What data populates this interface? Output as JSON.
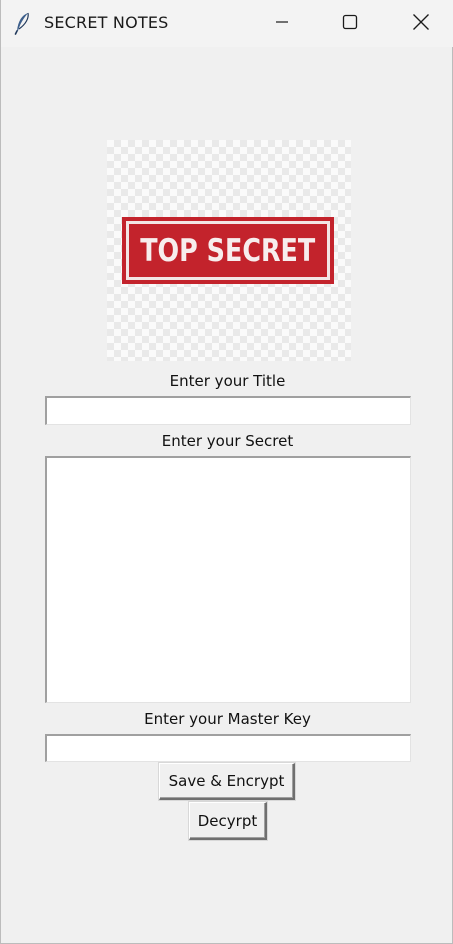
{
  "window": {
    "title": "SECRET NOTES",
    "icon": "feather-icon",
    "controls": [
      "minimize-icon",
      "maximize-icon",
      "close-icon"
    ]
  },
  "logo": {
    "stamp_text": "TOP SECRET",
    "stamp_color": "#c3232c"
  },
  "form": {
    "title_label": "Enter your Title",
    "title_value": "",
    "secret_label": "Enter your Secret",
    "secret_value": "",
    "key_label": "Enter your Master Key",
    "key_value": ""
  },
  "buttons": {
    "save_label": "Save & Encrypt",
    "decrypt_label": "Decyrpt"
  }
}
